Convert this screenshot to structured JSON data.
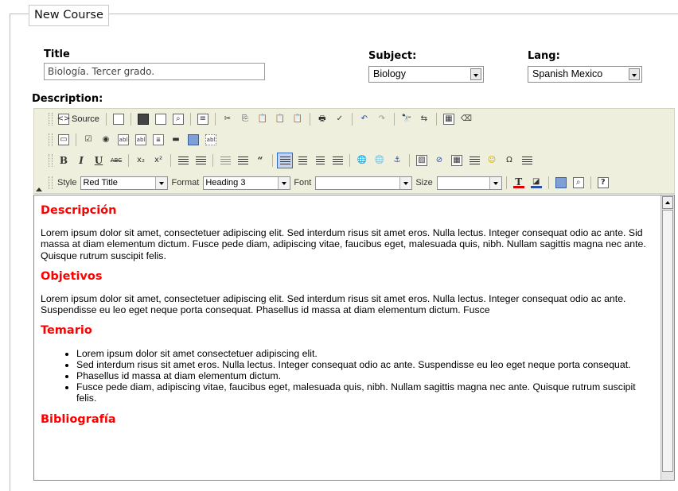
{
  "form": {
    "legend": "New Course",
    "title_label": "Title",
    "title_value": "Biología. Tercer grado.",
    "subject_label": "Subject:",
    "subject_value": "Biology",
    "lang_label": "Lang:",
    "lang_value": "Spanish Mexico",
    "description_label": "Description:"
  },
  "toolbar": {
    "source_label": "Source",
    "style_label": "Style",
    "style_value": "Red Title",
    "format_label": "Format",
    "format_value": "Heading 3",
    "font_label": "Font",
    "font_value": "",
    "size_label": "Size",
    "size_value": "",
    "icons": [
      "source-icon",
      "new-page-icon",
      "save-icon",
      "preview-icon",
      "templates-icon",
      "cut-icon",
      "copy-icon",
      "paste-icon",
      "paste-text-icon",
      "paste-word-icon",
      "print-icon",
      "spellcheck-icon",
      "undo-icon",
      "redo-icon",
      "find-icon",
      "replace-icon",
      "select-all-icon",
      "remove-format-icon",
      "form-icon",
      "checkbox-icon",
      "radio-icon",
      "textfield-icon",
      "textarea-icon",
      "select-field-icon",
      "button-icon",
      "image-button-icon",
      "hidden-field-icon",
      "bold-icon",
      "italic-icon",
      "underline-icon",
      "strikethrough-icon",
      "subscript-icon",
      "superscript-icon",
      "numbered-list-icon",
      "bulleted-list-icon",
      "outdent-icon",
      "indent-icon",
      "blockquote-icon",
      "align-left-icon",
      "align-center-icon",
      "align-right-icon",
      "justify-icon",
      "link-icon",
      "unlink-icon",
      "anchor-icon",
      "image-icon",
      "flash-icon",
      "table-icon",
      "horizontal-rule-icon",
      "smiley-icon",
      "special-char-icon",
      "page-break-icon",
      "text-color-icon",
      "bg-color-icon",
      "maximize-icon",
      "show-blocks-icon",
      "about-icon"
    ]
  },
  "content": {
    "h_descripcion": "Descripción",
    "p_descripcion": "Lorem ipsum dolor sit amet, consectetuer adipiscing elit. Sed interdum risus sit amet eros. Nulla lectus. Integer consequat odio ac ante. Sid massa at diam elementum dictum. Fusce pede diam, adipiscing vitae, faucibus eget, malesuada quis, nibh. Nullam sagittis magna nec ante. Quisque rutrum suscipit felis.",
    "h_objetivos": "Objetivos",
    "p_objetivos": "Lorem ipsum dolor sit amet, consectetuer adipiscing elit. Sed interdum risus sit amet eros. Nulla lectus. Integer consequat odio ac ante. Suspendisse eu leo eget neque porta consequat. Phasellus id massa at diam elementum dictum. Fusce",
    "h_temario": "Temario",
    "temario_items": [
      "Lorem ipsum dolor sit amet consectetuer adipiscing elit.",
      "Sed interdum risus sit amet eros. Nulla lectus. Integer consequat odio ac ante. Suspendisse eu leo eget neque porta consequat.",
      "Phasellus id massa at diam elementum dictum.",
      "Fusce pede diam, adipiscing vitae, faucibus eget, malesuada quis, nibh. Nullam sagittis magna nec ante. Quisque rutrum suscipit felis."
    ],
    "h_bibliografia": "Bibliografía"
  }
}
